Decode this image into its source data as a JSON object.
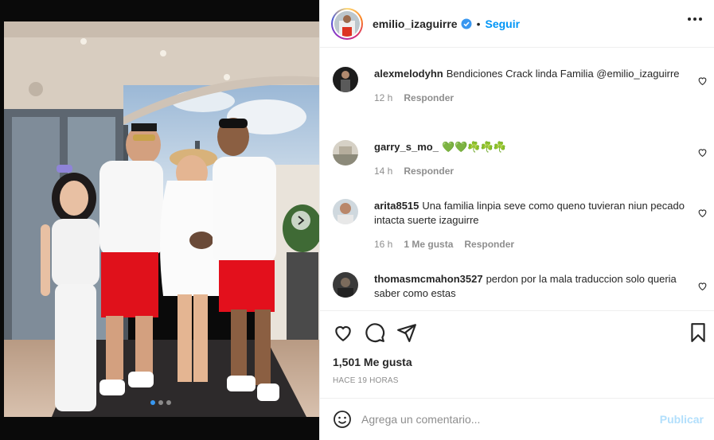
{
  "post": {
    "author": "emilio_izaguirre",
    "verified": true,
    "separator": "•",
    "follow_label": "Seguir",
    "more_icon": "more-horizontal-icon",
    "carousel": {
      "dots": 3,
      "active_index": 0
    }
  },
  "comments": [
    {
      "user": "alexmelodyhn",
      "text": "Bendiciones Crack linda Familia @emilio_izaguirre",
      "time": "12 h",
      "likes": "",
      "reply_label": "Responder"
    },
    {
      "user": "garry_s_mo_",
      "text": "💚💚☘️☘️☘️",
      "time": "14 h",
      "likes": "",
      "reply_label": "Responder"
    },
    {
      "user": "arita8515",
      "text": "Una familia linpia seve como queno tuvieran niun pecado intacta suerte izaguirre",
      "time": "16 h",
      "likes": "1 Me gusta",
      "reply_label": "Responder"
    },
    {
      "user": "thomasmcmahon3527",
      "text": "perdon por la mala traduccion solo queria saber como estas",
      "time": "",
      "likes": "",
      "reply_label": ""
    }
  ],
  "actions": {
    "like_icon": "heart-icon",
    "comment_icon": "comment-icon",
    "share_icon": "send-icon",
    "save_icon": "bookmark-icon"
  },
  "likes_text": "1,501 Me gusta",
  "time_ago": "HACE 19 HORAS",
  "composer": {
    "emoji_icon": "smiley-icon",
    "placeholder": "Agrega un comentario...",
    "publish_label": "Publicar"
  },
  "colors": {
    "accent": "#0095f6",
    "publish_disabled": "#b2dffc",
    "muted": "#8e8e8e"
  }
}
